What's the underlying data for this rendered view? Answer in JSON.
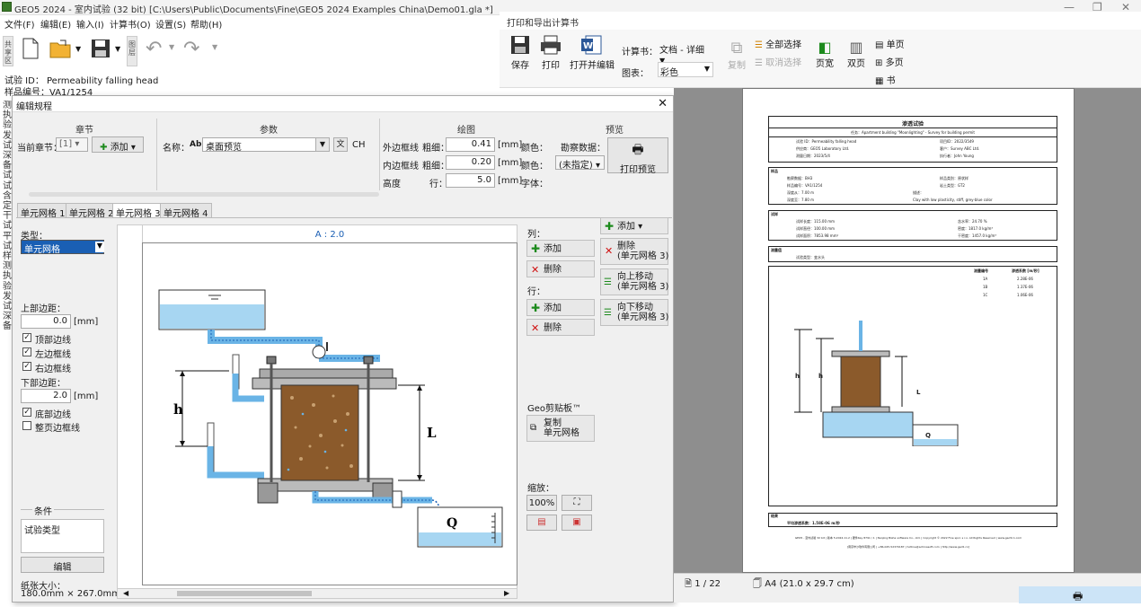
{
  "app": {
    "title": "GEO5 2024 - 室内试验 (32 bit) [C:\\Users\\Public\\Documents\\Fine\\GEO5 2024 Examples China\\Demo01.gla *]"
  },
  "menu": [
    "文件(F)",
    "编辑(E)",
    "输入(I)",
    "计算书(O)",
    "设置(S)",
    "帮助(H)"
  ],
  "left_vtab": "共享区",
  "toolbar_vtab": "图层",
  "info": {
    "test_id": "试验 ID： Permeability falling head",
    "sample_no": "样品编号：VA1/1254"
  },
  "side_labels": "测执验发试深备试试含定干试平试样测执验发试深备",
  "dialog": {
    "title": "编辑规程",
    "sections": {
      "chapter": "章节",
      "params": "参数",
      "drawing": "绘图",
      "preview": "预览"
    },
    "current_chapter_label": "当前章节：",
    "current_chapter_value": "[1]",
    "add": "添加",
    "name_label": "名称：",
    "name_value": "桌面预览",
    "ch": "CH",
    "outer_frame": "外边框线",
    "inner_frame": "内边框线",
    "height": "高度",
    "thickness": "粗细：",
    "row": "行：",
    "outer_value": "0.41",
    "inner_value": "0.20",
    "height_value": "5.0",
    "unit_mm": "[mm]",
    "color": "颜色：",
    "font": "字体：",
    "survey_data": "勘察数据：",
    "unspecified": "(未指定)",
    "print_preview": "打印预览",
    "tabs": [
      "单元网格 1",
      "单元网格 2",
      "单元网格 3",
      "单元网格 4"
    ],
    "type_label": "类型：",
    "type_value": "单元网格",
    "top_margin": "上部边距：",
    "top_margin_value": "0.0",
    "bottom_margin": "下部边距：",
    "bottom_margin_value": "2.0",
    "checks": [
      {
        "label": "顶部边线",
        "checked": "✓"
      },
      {
        "label": "左边框线",
        "checked": "✓"
      },
      {
        "label": "右边框线",
        "checked": "✓"
      }
    ],
    "bottom_check": {
      "label": "底部边线",
      "checked": "✓"
    },
    "page_frame": "整页边框线",
    "conditions": "条件",
    "test_type": "试验类型",
    "edit": "编辑",
    "paper_size_label": "纸张大小：",
    "paper_size": "180.0mm × 267.0mm",
    "grid_header": "A : 2.0",
    "col_label": "列：",
    "row_label": "行：",
    "add_btn": "添加",
    "delete_btn": "删除",
    "add_top": "添加",
    "delete_cell": "删除\n(单元网格 3)",
    "move_up": "向上移动\n(单元网格 3)",
    "move_down": "向下移动\n(单元网格 3)",
    "clipboard": "Geo剪贴板™",
    "copy_cell": "复制\n单元网格",
    "zoom": "缩放：",
    "zoom_value": "100%",
    "diagram": {
      "h": "h",
      "L": "L",
      "Q": "Q"
    }
  },
  "print_panel": {
    "title": "打印和导出计算书",
    "save": "保存",
    "print": "打印",
    "open_edit": "打开并编辑",
    "report_label": "计算书：",
    "report_value": "文档 - 详细",
    "figure_label": "图表：",
    "figure_value": "彩色",
    "copy": "复制",
    "select_all": "全部选择",
    "deselect_all": "取消选择",
    "page_width": "页宽",
    "double_page": "双页",
    "single_page": "单页",
    "multi_page": "多页",
    "book": "书",
    "page": "1 / 22",
    "paper": "A4 (21.0 x 29.7 cm)"
  },
  "report": {
    "title": "渗透试验",
    "task": "任务：Apartment building \"Moonlighting\" - Survey for building permit",
    "rows1": [
      "试验 ID：Permeability falling head",
      "项目ID：2022/3549",
      "供应商：GEO5 Laboratory Ltd.",
      "客户：Survey ABC Ltd.",
      "测量日期：2023/5/4",
      "执行者：John Young"
    ],
    "sample_head": "样品",
    "rows2": [
      "勘察数据：BH3",
      "样品类别：原状样",
      "样品编号：VA1/1254",
      "岩土类型：GT2",
      "深度从：7.00 m",
      "描述：",
      "深度至：7.80 m",
      "Clay with low plasticity, stiff, grey-blue color"
    ],
    "specimen_head": "试样",
    "rows3": [
      "试样长度：115.00 mm",
      "含水率：24.70 %",
      "试样直径：100.00 mm",
      "密度：1817.0 kg/m³",
      "试样面积：7853.98 mm²",
      "干密度：1457.0 kg/m³"
    ],
    "measure_head": "测量值",
    "test_type": "试验类型：变水头",
    "table_head": [
      "测量编号",
      "渗透系数 [m/秒]"
    ],
    "table_rows": [
      [
        "1A",
        "2.28E-06"
      ],
      [
        "1B",
        "1.37E-06"
      ],
      [
        "1C",
        "1.06E-06"
      ]
    ],
    "result_head": "结果",
    "result": "平均渗透系数：1.58E-06 m/秒",
    "footer1": "GEO5 - 室内试验 32 bit | 版本 5.2024.11.2 | 硬件Key 8791 / 1 | Nanjing Bisha software Co., Ltd. | Copyright © 2022 Fine spol. s r.o. All Rights Reserved | www.geo5cn.com",
    "footer2": "[南京毕沙软件有限公司 | +86-025-52370187 | hotline@achinasoft.com | http://www.geo5.cn]"
  }
}
